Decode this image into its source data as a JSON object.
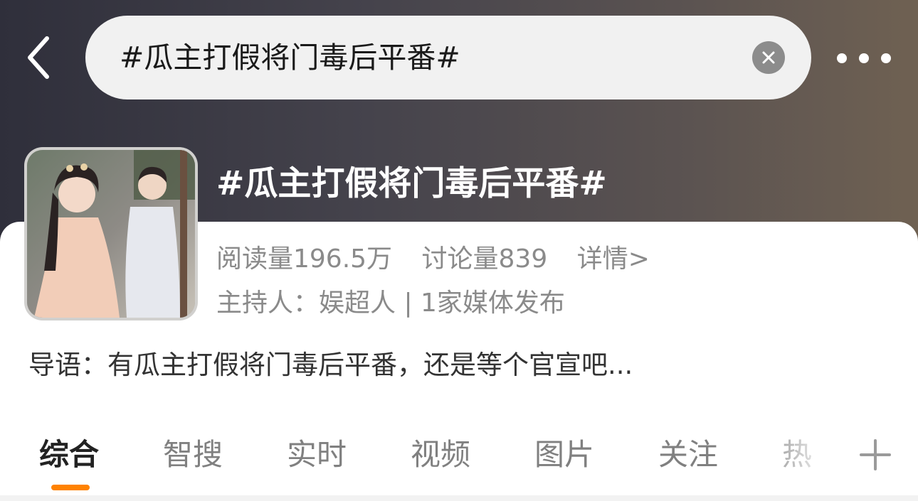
{
  "search": {
    "query": "#瓜主打假将门毒后平番#"
  },
  "topic": {
    "title": "#瓜主打假将门毒后平番#",
    "reads": "阅读量196.5万",
    "discussions": "讨论量839",
    "detail_link": "详情>",
    "host": "主持人：娱超人 | 1家媒体发布",
    "intro": "导语：有瓜主打假将门毒后平番，还是等个官宣吧..."
  },
  "tabs": [
    {
      "label": "综合",
      "active": true
    },
    {
      "label": "智搜",
      "active": false
    },
    {
      "label": "实时",
      "active": false
    },
    {
      "label": "视频",
      "active": false
    },
    {
      "label": "图片",
      "active": false
    },
    {
      "label": "关注",
      "active": false
    },
    {
      "label": "热",
      "active": false
    }
  ],
  "icons": {
    "back": "chevron-left-icon",
    "clear": "close-circle-icon",
    "more": "more-horizontal-icon",
    "add": "plus-icon"
  },
  "colors": {
    "accent": "#ff8200",
    "header_start": "#2f2f3b",
    "header_end": "#6f6152"
  }
}
